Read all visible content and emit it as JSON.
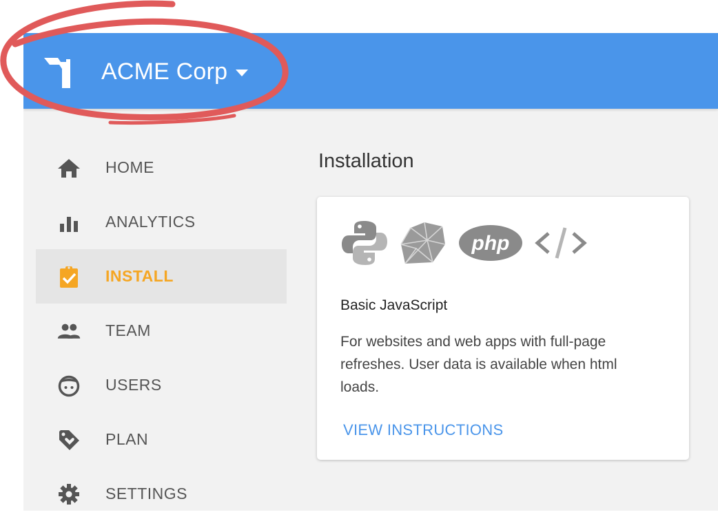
{
  "theme": {
    "topbar_color": "#4a95ea",
    "accent_active": "#f5a623",
    "link_color": "#4a95ea",
    "annotation_color": "#e05a5a",
    "background": "#f2f2f2"
  },
  "header": {
    "brand_icon": "flag-icon",
    "org_name": "ACME Corp",
    "org_switcher_icon": "caret-down-icon"
  },
  "sidebar": {
    "items": [
      {
        "label": "HOME",
        "icon": "home-icon",
        "active": false
      },
      {
        "label": "ANALYTICS",
        "icon": "bar-chart-icon",
        "active": false
      },
      {
        "label": "INSTALL",
        "icon": "clipboard-check-icon",
        "active": true
      },
      {
        "label": "TEAM",
        "icon": "people-icon",
        "active": false
      },
      {
        "label": "USERS",
        "icon": "face-icon",
        "active": false
      },
      {
        "label": "PLAN",
        "icon": "tag-heart-icon",
        "active": false
      },
      {
        "label": "SETTINGS",
        "icon": "gear-icon",
        "active": false
      }
    ]
  },
  "main": {
    "section_title": "Installation",
    "card": {
      "icons": [
        "python-icon",
        "ruby-icon",
        "php-icon",
        "code-icon"
      ],
      "php_label": "php",
      "title": "Basic JavaScript",
      "description": "For websites and web apps with full-page refreshes. User data is available when html loads.",
      "link_label": "VIEW INSTRUCTIONS"
    }
  }
}
